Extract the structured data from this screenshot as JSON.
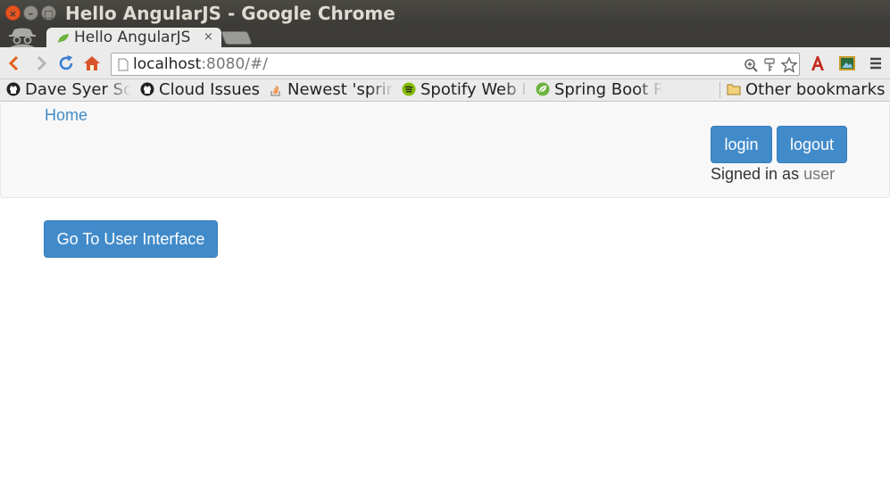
{
  "window": {
    "title": "Hello AngularJS - Google Chrome",
    "close_glyph": "×",
    "min_glyph": "–",
    "max_glyph": "□"
  },
  "tabs": [
    {
      "label": "Hello AngularJS",
      "close_glyph": "×",
      "icon": "spring-leaf-icon"
    }
  ],
  "toolbar": {
    "url_host": "localhost",
    "url_rest": ":8080/#/",
    "icons": [
      "back-icon",
      "forward-icon",
      "reload-icon",
      "home-icon",
      "page-icon",
      "zoom-icon",
      "key-icon",
      "star-icon",
      "acrobat-icon",
      "image-ext-icon",
      "menu-icon"
    ]
  },
  "bookmarks": {
    "items": [
      {
        "label": "Dave Syer Sc",
        "icon": "github-icon"
      },
      {
        "label": "Cloud Issues",
        "icon": "github-icon"
      },
      {
        "label": "Newest 'sprir",
        "icon": "stackoverflow-icon"
      },
      {
        "label": "Spotify Web I",
        "icon": "spotify-icon"
      },
      {
        "label": "Spring Boot R",
        "icon": "spring-icon"
      }
    ],
    "other": "Other bookmarks"
  },
  "page": {
    "nav": {
      "home": "Home",
      "login": "login",
      "logout": "logout",
      "signed_in_prefix": "Signed in as",
      "username": "user"
    },
    "main": {
      "ui_button": "Go To User Interface"
    }
  },
  "colors": {
    "primary": "#428bca",
    "titlebar": "#3c3b37",
    "close": "#e95420"
  }
}
